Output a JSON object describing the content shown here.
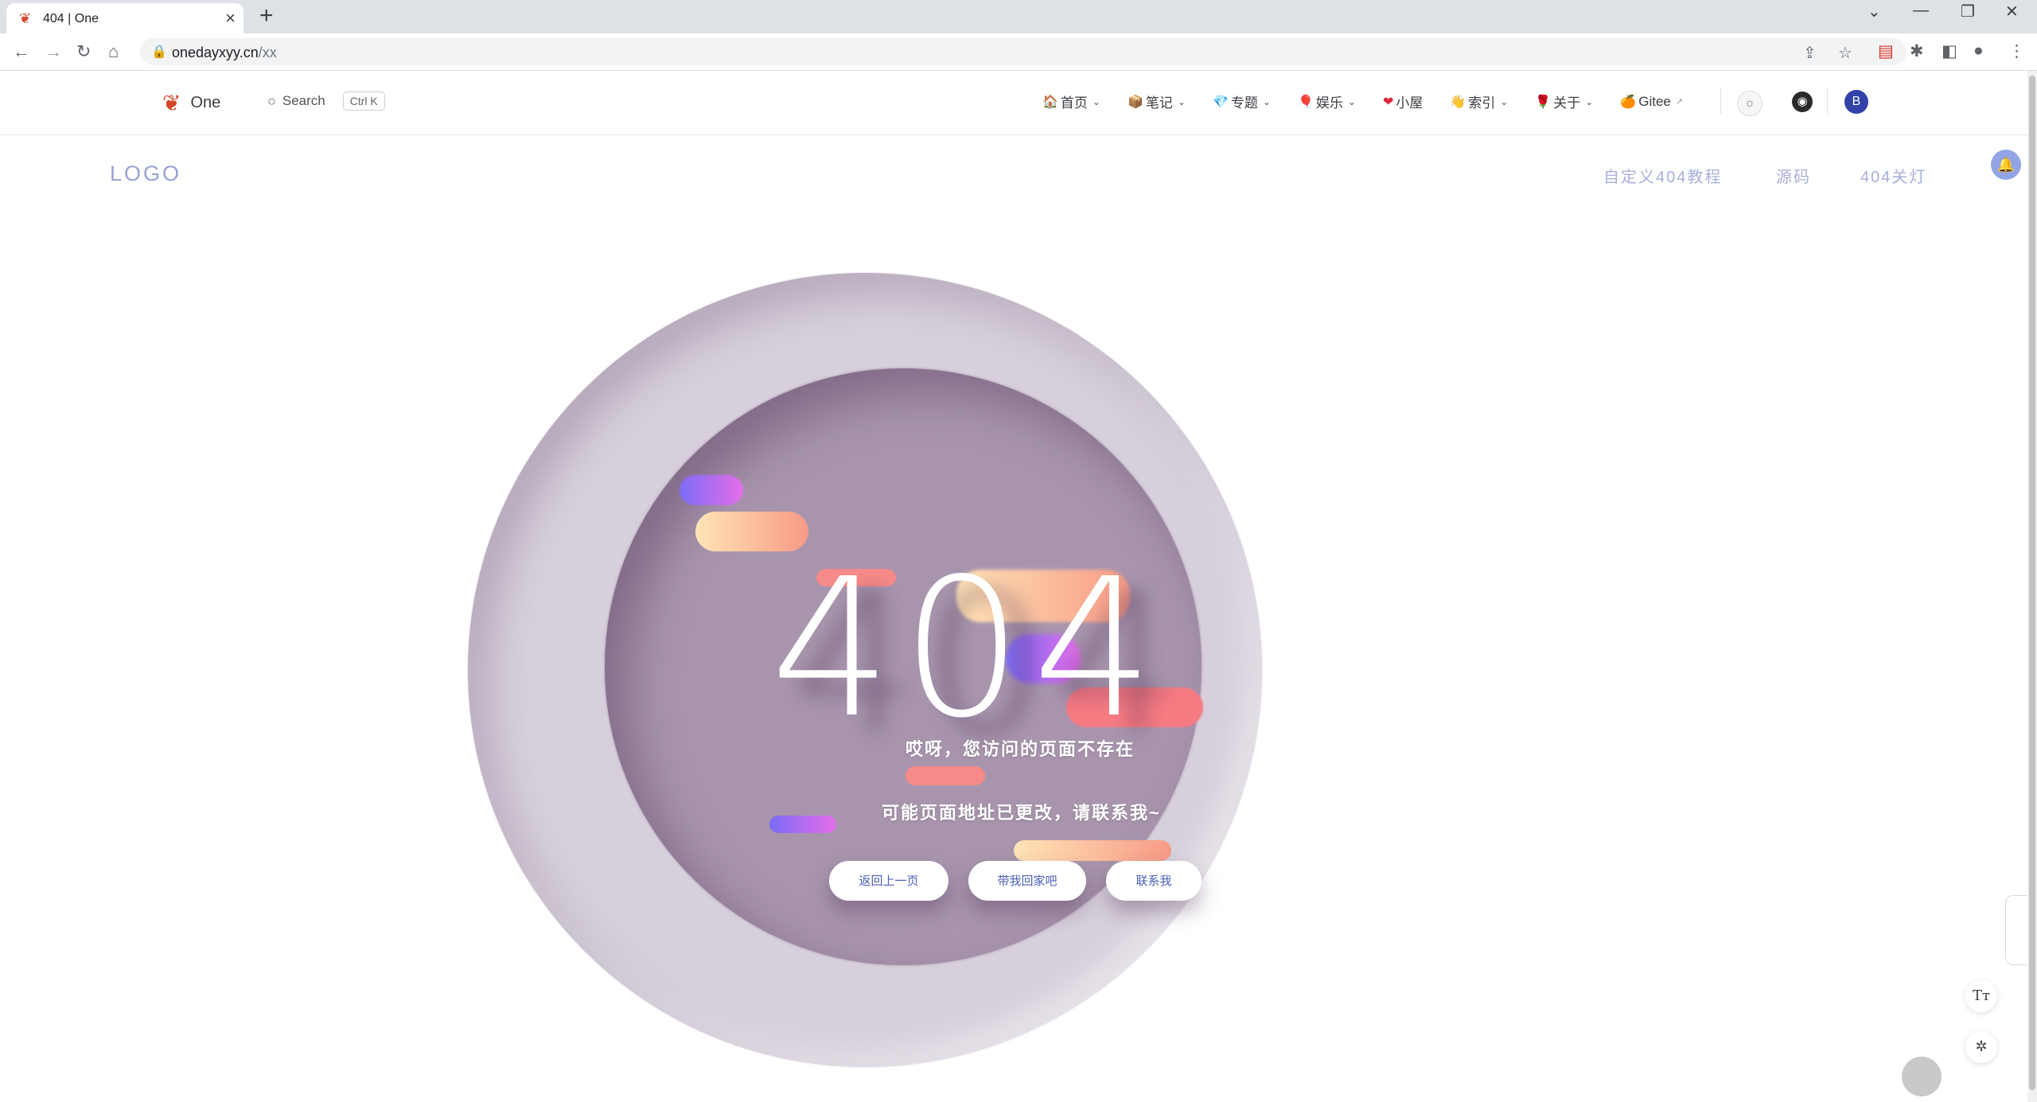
{
  "browser": {
    "tab_title": "404 | One",
    "url_host": "onedayxyy.cn",
    "url_path": "/xx",
    "new_tab": "+",
    "tab_close": "×"
  },
  "header": {
    "brand": "One",
    "search_label": "Search",
    "search_shortcut": "Ctrl K",
    "menu": [
      {
        "icon": "🏠",
        "label": "首页",
        "dropdown": true
      },
      {
        "icon": "📦",
        "label": "笔记",
        "dropdown": true
      },
      {
        "icon": "💎",
        "label": "专题",
        "dropdown": true
      },
      {
        "icon": "🎈",
        "label": "娱乐",
        "dropdown": true
      },
      {
        "icon": "❤",
        "label": "小屋",
        "dropdown": false
      },
      {
        "icon": "👋",
        "label": "索引",
        "dropdown": true
      },
      {
        "icon": "🌹",
        "label": "关于",
        "dropdown": true
      },
      {
        "icon": "🍊",
        "label": "Gitee",
        "dropdown": false,
        "external": "↗"
      }
    ],
    "avatar_letter": "B"
  },
  "page": {
    "logo": "LOGO",
    "top_links": [
      "自定义404教程",
      "源码",
      "404关灯"
    ],
    "error_code": "404",
    "message_1": "哎呀，您访问的页面不存在",
    "message_2": "可能页面地址已更改，请联系我~",
    "buttons": {
      "back": "返回上一页",
      "home": "带我回家吧",
      "contact": "联系我"
    }
  },
  "tools": {
    "font_size": "Tт"
  },
  "colors": {
    "outer_circle": "#d7cfdb",
    "inner_circle": "#a895ad",
    "link": "#a7b0da",
    "button_text": "#4a5fb5"
  }
}
